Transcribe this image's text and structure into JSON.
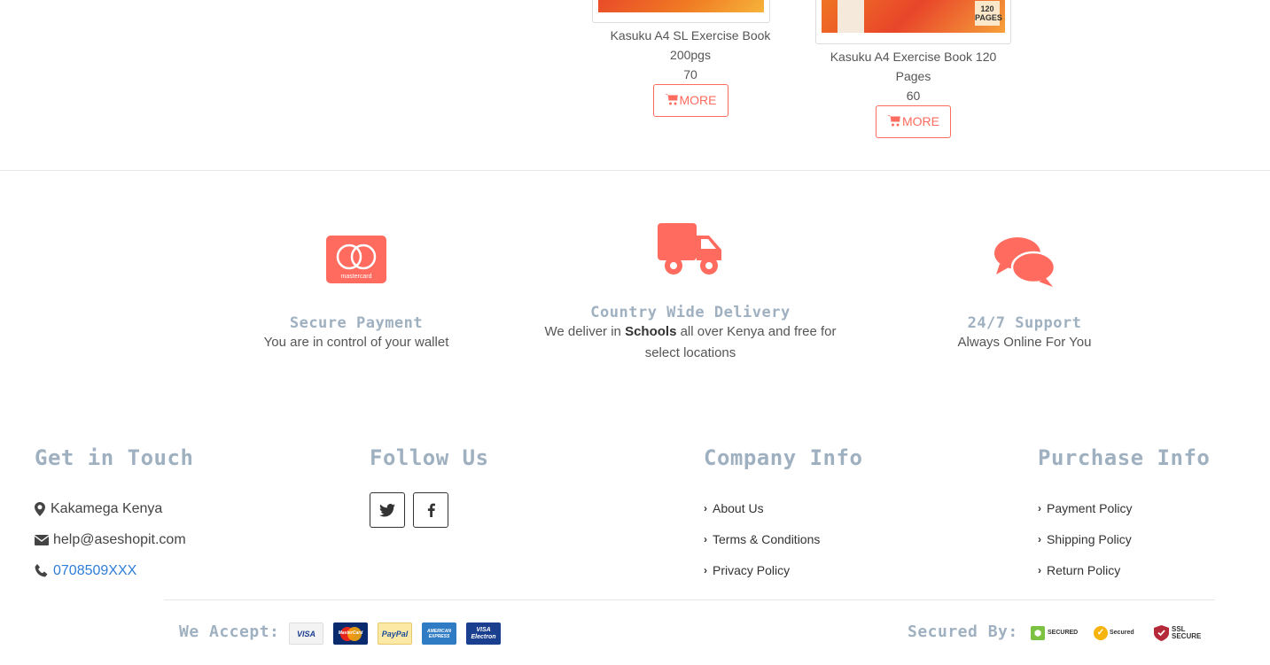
{
  "products": [
    {
      "name_line1": "Kasuku A4 SL Exercise Book",
      "name_line2": "200pgs",
      "price": "70",
      "button": "MORE"
    },
    {
      "name_line1": "Kasuku A4 Exercise Book 120",
      "name_line2": "Pages",
      "price": "60",
      "button": "MORE",
      "cover_text": "120\nPAGES"
    }
  ],
  "features": [
    {
      "icon": "mastercard-icon",
      "title": "Secure Payment",
      "desc": "You are in control of your wallet",
      "card_text": "mastercard"
    },
    {
      "icon": "truck-icon",
      "title": "Country Wide Delivery",
      "desc_pre": "We deliver in ",
      "desc_bold": "Schools",
      "desc_post": " all over Kenya and free for select locations"
    },
    {
      "icon": "comments-icon",
      "title": "24/7 Support",
      "desc": "Always Online For You"
    }
  ],
  "footer": {
    "contact": {
      "heading": "Get in Touch",
      "location": "Kakamega Kenya",
      "email": "help@aseshopit.com",
      "phone": "0708509XXX"
    },
    "follow": {
      "heading": "Follow Us",
      "icons": [
        "twitter-icon",
        "facebook-icon"
      ]
    },
    "company": {
      "heading": "Company Info",
      "links": [
        "About Us",
        "Terms & Conditions",
        "Privacy Policy"
      ]
    },
    "purchase": {
      "heading": "Purchase Info",
      "links": [
        "Payment Policy",
        "Shipping Policy",
        "Return Policy"
      ]
    },
    "accept_label": "We Accept:",
    "cards": [
      "VISA",
      "MasterCard",
      "PayPal",
      "AMERICAN EXPRESS",
      "VISA Electron"
    ],
    "secured_label": "Secured By:",
    "seals": [
      "SECURED",
      "Secured",
      "SSL SECURE"
    ]
  },
  "colors": {
    "accent": "#ff6b5e",
    "heading": "#9fb0c0",
    "link": "#2f7ed8"
  }
}
